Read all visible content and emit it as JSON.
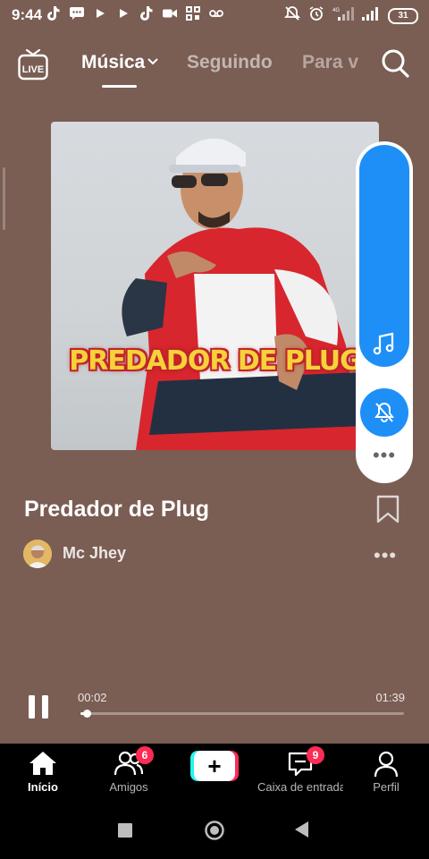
{
  "status_bar": {
    "time": "9:44",
    "battery": "31",
    "network": "4G"
  },
  "top_nav": {
    "live_label": "LIVE",
    "tabs": [
      {
        "label": "Música",
        "active": true
      },
      {
        "label": "Seguindo",
        "active": false
      },
      {
        "label": "Para v",
        "active": false
      }
    ]
  },
  "album": {
    "cover_text": "PREDADOR DE PLUG"
  },
  "song": {
    "title": "Predador de Plug",
    "artist": "Mc Jhey",
    "more": "•••"
  },
  "player": {
    "current_time": "00:02",
    "total_time": "01:39",
    "progress": 0.02
  },
  "side_pill": {
    "more": "•••"
  },
  "bottom_nav": {
    "items": [
      {
        "label": "Início",
        "icon": "home-icon",
        "active": true
      },
      {
        "label": "Amigos",
        "icon": "friends-icon",
        "badge": "6"
      },
      {
        "label": "",
        "icon": "create-icon"
      },
      {
        "label": "Caixa de entrada",
        "icon": "inbox-icon",
        "badge": "9"
      },
      {
        "label": "Perfil",
        "icon": "profile-icon"
      }
    ]
  },
  "colors": {
    "background": "#7a5d53",
    "accent_blue": "#1e8ff7",
    "badge_red": "#fe2c55",
    "create_cyan": "#25f4ee"
  }
}
